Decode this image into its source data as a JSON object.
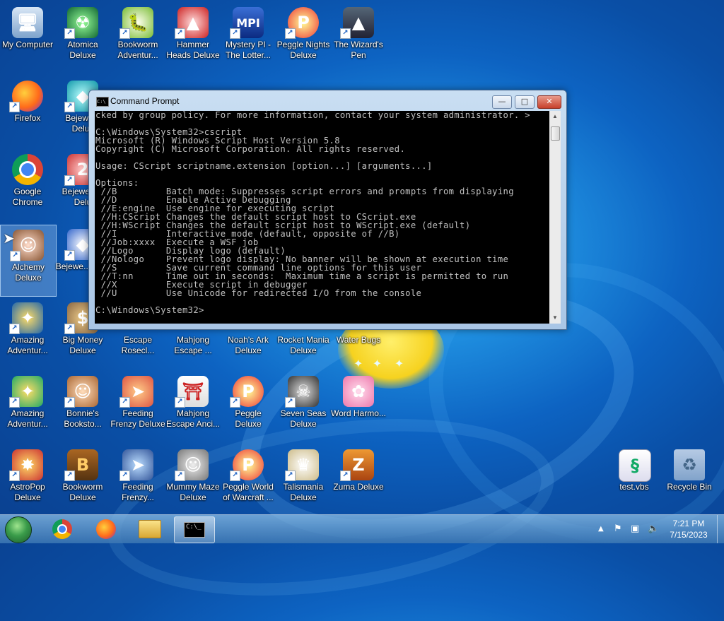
{
  "desktop": {
    "icons": [
      {
        "label": "My Computer"
      },
      {
        "label": "Atomica Deluxe"
      },
      {
        "label": "Bookworm Adventur..."
      },
      {
        "label": "Hammer Heads Deluxe"
      },
      {
        "label": "Mystery PI - The Lotter..."
      },
      {
        "label": "Peggle Nights Deluxe"
      },
      {
        "label": "The Wizard's Pen"
      },
      {
        "label": "Firefox"
      },
      {
        "label": "Bejewe... Delux"
      },
      {
        "label": "Google Chrome"
      },
      {
        "label": "Bejewele... Delu"
      },
      {
        "label": "Alchemy Deluxe"
      },
      {
        "label": "Bejewe... Twis"
      },
      {
        "label": "Amazing Adventur..."
      },
      {
        "label": "Big Money Deluxe"
      },
      {
        "label": "Escape Rosecl..."
      },
      {
        "label": "Mahjong Escape ..."
      },
      {
        "label": "Noah's Ark Deluxe"
      },
      {
        "label": "Rocket Mania Deluxe"
      },
      {
        "label": "Water Bugs"
      },
      {
        "label": "Amazing Adventur..."
      },
      {
        "label": "Bonnie's Booksto..."
      },
      {
        "label": "Feeding Frenzy Deluxe"
      },
      {
        "label": "Mahjong Escape Anci..."
      },
      {
        "label": "Peggle Deluxe"
      },
      {
        "label": "Seven Seas Deluxe"
      },
      {
        "label": "Word Harmo..."
      },
      {
        "label": "AstroPop Deluxe"
      },
      {
        "label": "Bookworm Deluxe"
      },
      {
        "label": "Feeding Frenzy..."
      },
      {
        "label": "Mummy Maze Deluxe"
      },
      {
        "label": "Peggle World of Warcraft ..."
      },
      {
        "label": "Talismania Deluxe"
      },
      {
        "label": "Zuma Deluxe"
      },
      {
        "label": "test.vbs"
      },
      {
        "label": "Recycle Bin"
      }
    ]
  },
  "cmd": {
    "title": "Command Prompt",
    "buttons": {
      "minimize": "—",
      "maximize": "□",
      "close": "✕"
    },
    "lines": [
      "cked by group policy. For more information, contact your system administrator. >",
      "",
      "C:\\Windows\\System32>cscript",
      "Microsoft (R) Windows Script Host Version 5.8",
      "Copyright (C) Microsoft Corporation. All rights reserved.",
      "",
      "Usage: CScript scriptname.extension [option...] [arguments...]",
      "",
      "Options:",
      " //B         Batch mode: Suppresses script errors and prompts from displaying",
      " //D         Enable Active Debugging",
      " //E:engine  Use engine for executing script",
      " //H:CScript Changes the default script host to CScript.exe",
      " //H:WScript Changes the default script host to WScript.exe (default)",
      " //I         Interactive mode (default, opposite of //B)",
      " //Job:xxxx  Execute a WSF job",
      " //Logo      Display logo (default)",
      " //Nologo    Prevent logo display: No banner will be shown at execution time",
      " //S         Save current command line options for this user",
      " //T:nn      Time out in seconds:  Maximum time a script is permitted to run",
      " //X         Execute script in debugger",
      " //U         Use Unicode for redirected I/O from the console",
      "",
      "C:\\Windows\\System32>"
    ]
  },
  "taskbar": {
    "clock_time": "7:21 PM",
    "clock_date": "7/15/2023",
    "tray_icons": [
      "show-hidden-icon",
      "action-center-icon",
      "network-icon",
      "volume-icon"
    ]
  },
  "colors": {
    "wallpaper": "#0d63c2",
    "console_bg": "#000000",
    "console_fg": "#c0c0c0"
  }
}
